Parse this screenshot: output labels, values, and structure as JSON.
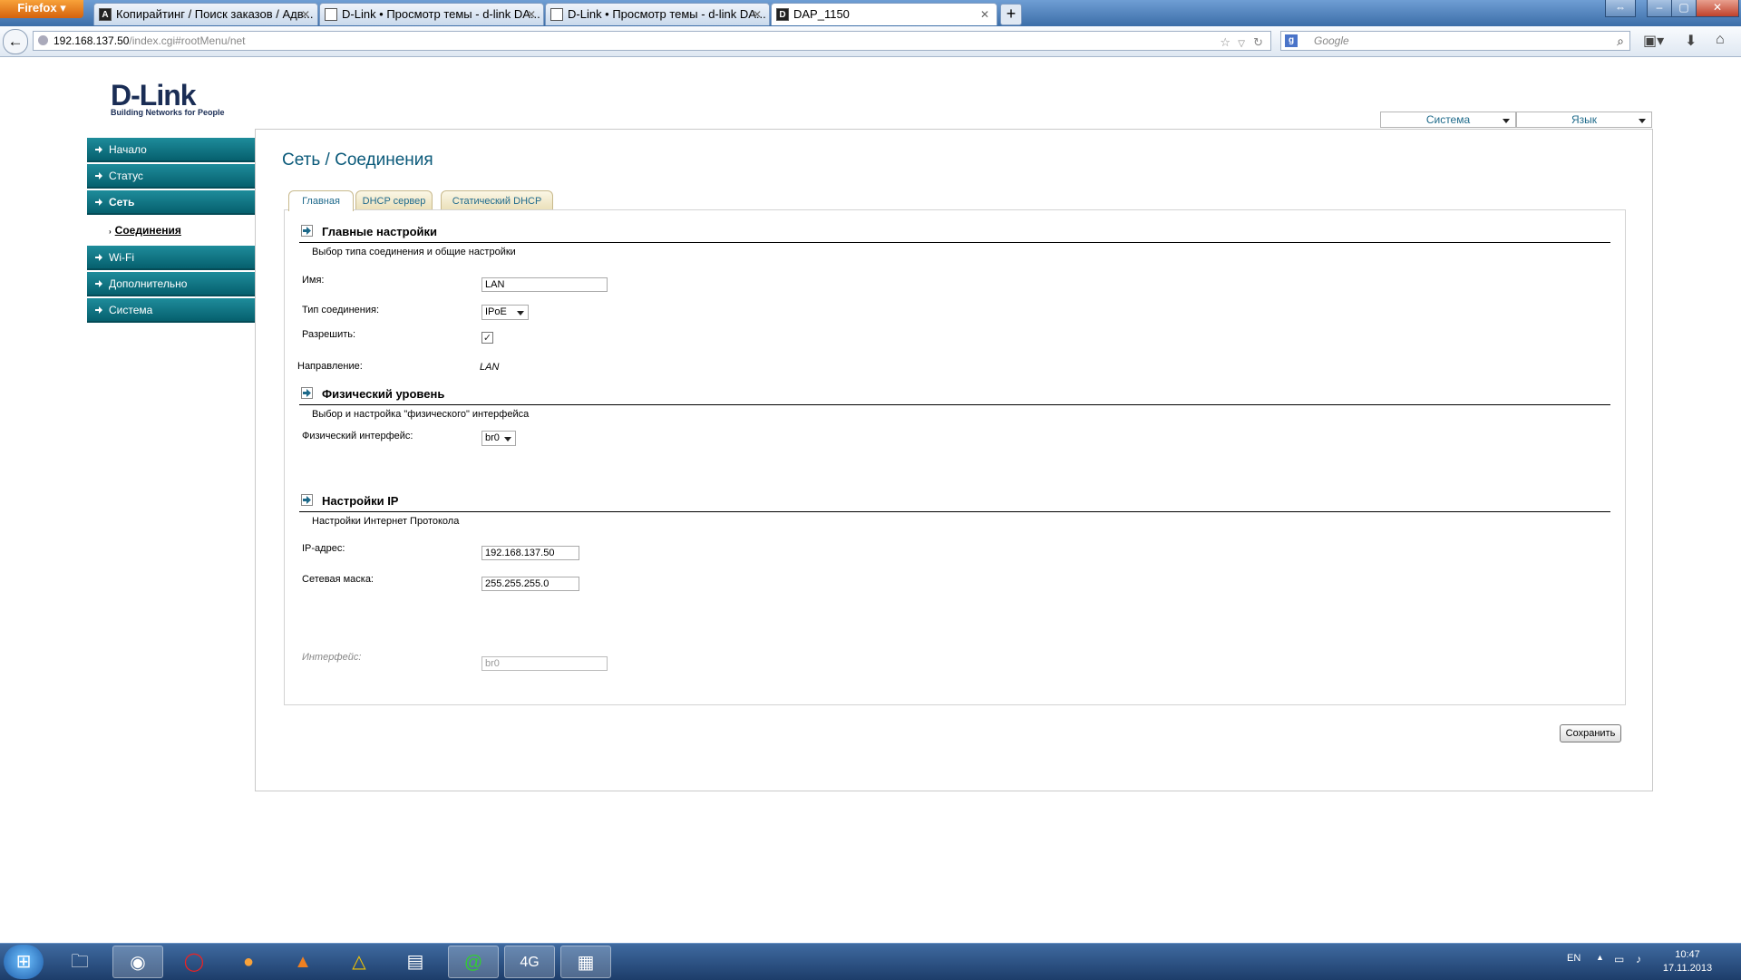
{
  "browser": {
    "menu_button": "Firefox",
    "tabs": [
      {
        "label": "Копирайтинг / Поиск заказов / Адв...",
        "favicon": "A"
      },
      {
        "label": "D-Link • Просмотр темы - d-link DA...",
        "favicon": ""
      },
      {
        "label": "D-Link • Просмотр темы - d-link DA...",
        "favicon": ""
      },
      {
        "label": "DAP_1150",
        "favicon": "D"
      }
    ],
    "url_host": "192.168.137.50",
    "url_path": "/index.cgi#rootMenu/net",
    "search_placeholder": "Google"
  },
  "header": {
    "logo_brand": "D-Link",
    "logo_tagline": "Building Networks for People",
    "system_select": "Система",
    "language_select": "Язык"
  },
  "sidebar": {
    "items": [
      {
        "label": "Начало"
      },
      {
        "label": "Статус"
      },
      {
        "label": "Сеть"
      },
      {
        "label": "Wi-Fi"
      },
      {
        "label": "Дополнительно"
      },
      {
        "label": "Система"
      }
    ],
    "sub_item": "Соединения"
  },
  "main": {
    "title": "Сеть / Соединения",
    "tabs": [
      "Главная",
      "DHCP сервер",
      "Статический DHCP"
    ],
    "general": {
      "heading": "Главные настройки",
      "subtitle": "Выбор типа соединения и общие настройки",
      "name_label": "Имя:",
      "name_value": "LAN",
      "conn_type_label": "Тип соединения:",
      "conn_type_value": "IPoE",
      "enable_label": "Разрешить:",
      "enable_checked": "✓",
      "direction_label": "Направление:",
      "direction_value": "LAN"
    },
    "physical": {
      "heading": "Физический уровень",
      "subtitle": "Выбор и настройка \"физического\" интерфейса",
      "iface_label": "Физический интерфейс:",
      "iface_value": "br0"
    },
    "ip": {
      "heading": "Настройки IP",
      "subtitle": "Настройки Интернет Протокола",
      "ip_label": "IP-адрес:",
      "ip_value": "192.168.137.50",
      "mask_label": "Сетевая маска:",
      "mask_value": "255.255.255.0",
      "iface_label": "Интерфейс:",
      "iface_value": "br0"
    },
    "save_label": "Сохранить"
  },
  "taskbar": {
    "lang": "EN",
    "time": "10:47",
    "date": "17.11.2013"
  },
  "colors": {
    "sidebar": "#0b6f7c",
    "title": "#0b5a7a",
    "titlebar": "#3c6ea8"
  }
}
